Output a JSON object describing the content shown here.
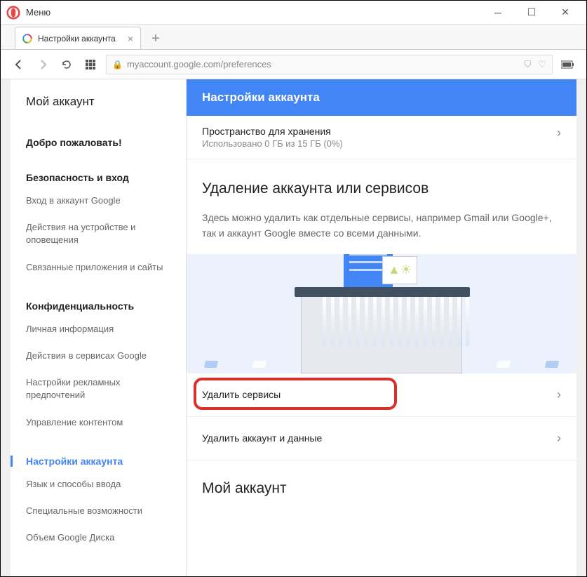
{
  "window": {
    "menu_label": "Меню"
  },
  "tab": {
    "title": "Настройки аккаунта"
  },
  "address": {
    "url": "myaccount.google.com/preferences"
  },
  "sidebar": {
    "title": "Мой аккаунт",
    "welcome": "Добро пожаловать!",
    "security_head": "Безопасность и вход",
    "security_items": {
      "signin": "Вход в аккаунт Google",
      "devices": "Действия на устройстве и оповещения",
      "apps": "Связанные приложения и сайты"
    },
    "privacy_head": "Конфиденциальность",
    "privacy_items": {
      "personal": "Личная информация",
      "activity": "Действия в сервисах Google",
      "ads": "Настройки рекламных предпочтений",
      "content": "Управление контентом"
    },
    "settings_head": "Настройки аккаунта",
    "settings_items": {
      "lang": "Язык и способы ввода",
      "access": "Специальные возможности",
      "drive": "Объем Google Диска"
    }
  },
  "main": {
    "header": "Настройки аккаунта",
    "storage": {
      "title": "Пространство для хранения",
      "sub": "Использовано 0 ГБ из 15 ГБ (0%)"
    },
    "delete_block": {
      "title": "Удаление аккаунта или сервисов",
      "desc": "Здесь можно удалить как отдельные сервисы, например Gmail или Google+, так и аккаунт Google вместе со всеми данными."
    },
    "options": {
      "delete_services": "Удалить сервисы",
      "delete_account": "Удалить аккаунт и данные"
    },
    "my_account_head": "Мой аккаунт"
  }
}
